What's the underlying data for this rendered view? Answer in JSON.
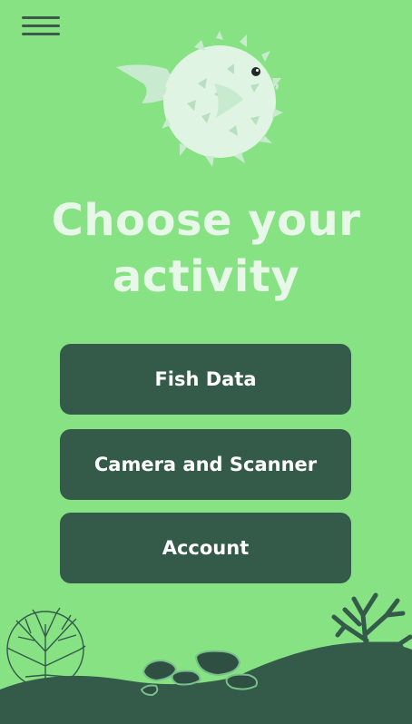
{
  "header": {
    "menu_icon": "hamburger-menu-icon",
    "mascot_icon": "pufferfish-icon"
  },
  "headline": {
    "line1": "Choose your",
    "line2": "activity"
  },
  "activities": [
    {
      "label": "Fish Data"
    },
    {
      "label": "Camera and Scanner"
    },
    {
      "label": "Account"
    }
  ],
  "colors": {
    "background": "#86e283",
    "button": "#345a4a",
    "button_text": "#ffffff",
    "headline": "#e8f8e8",
    "seabed": "#345a4a"
  }
}
